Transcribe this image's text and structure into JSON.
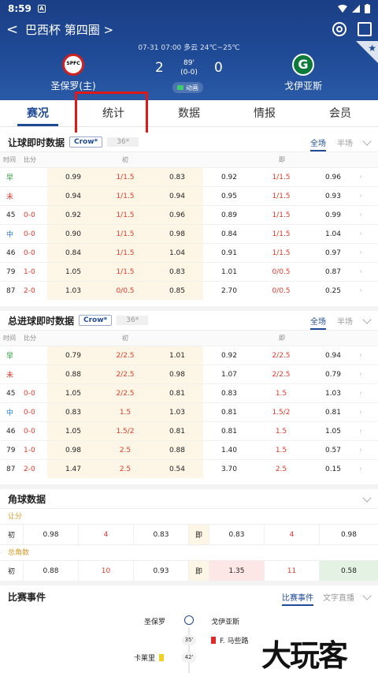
{
  "status": {
    "time": "8:59",
    "notif": "A"
  },
  "header": {
    "title": "巴西杯 第四圈 >",
    "back": "<",
    "meta": "07-31 07:00  多云 24℃~25℃",
    "home_name": "圣保罗(主)",
    "away_name": "戈伊亚斯",
    "away_logo": "G",
    "home_score": "2",
    "away_score": "0",
    "minute": "89'",
    "half_score": "(0-0)",
    "anim_label": "动画",
    "colors": {
      "bg": "#1f4a96",
      "accent": "#e01818"
    }
  },
  "tabs": [
    "赛况",
    "统计",
    "数据",
    "情报",
    "会员"
  ],
  "handicap": {
    "title": "让球即时数据",
    "badge": "Crow*",
    "badge2": "36*",
    "full": "全场",
    "half": "半场",
    "cols": {
      "time": "时间",
      "score": "比分",
      "early": "初",
      "live": "即"
    },
    "rows": [
      {
        "t": "早",
        "s": "",
        "a": "0.99",
        "b": "1/1.5",
        "c": "0.83",
        "d": "0.92",
        "e": "1/1.5",
        "f": "0.96"
      },
      {
        "t": "未",
        "s": "",
        "a": "0.94",
        "b": "1/1.5",
        "c": "0.94",
        "d": "0.95",
        "e": "1/1.5",
        "f": "0.93"
      },
      {
        "t": "45",
        "s": "0-0",
        "a": "0.92",
        "b": "1/1.5",
        "c": "0.96",
        "d": "0.89",
        "e": "1/1.5",
        "f": "0.99"
      },
      {
        "t": "中",
        "s": "0-0",
        "a": "0.90",
        "b": "1/1.5",
        "c": "0.98",
        "d": "0.84",
        "e": "1/1.5",
        "f": "1.04"
      },
      {
        "t": "46",
        "s": "0-0",
        "a": "0.84",
        "b": "1/1.5",
        "c": "1.04",
        "d": "0.91",
        "e": "1/1.5",
        "f": "0.97"
      },
      {
        "t": "79",
        "s": "1-0",
        "a": "1.05",
        "b": "1/1.5",
        "c": "0.83",
        "d": "1.01",
        "e": "0/0.5",
        "f": "0.87"
      },
      {
        "t": "87",
        "s": "2-0",
        "a": "1.03",
        "b": "0/0.5",
        "c": "0.85",
        "d": "2.70",
        "e": "0/0.5",
        "f": "0.25"
      }
    ]
  },
  "totals": {
    "title": "总进球即时数据",
    "badge": "Crow*",
    "badge2": "36*",
    "full": "全场",
    "half": "半场",
    "cols": {
      "time": "时间",
      "score": "比分",
      "early": "初",
      "live": "即"
    },
    "rows": [
      {
        "t": "早",
        "s": "",
        "a": "0.79",
        "b": "2/2.5",
        "c": "1.01",
        "d": "0.92",
        "e": "2/2.5",
        "f": "0.94"
      },
      {
        "t": "未",
        "s": "",
        "a": "0.88",
        "b": "2/2.5",
        "c": "0.98",
        "d": "1.07",
        "e": "2/2.5",
        "f": "0.79"
      },
      {
        "t": "45",
        "s": "0-0",
        "a": "1.05",
        "b": "2/2.5",
        "c": "0.81",
        "d": "0.83",
        "e": "1.5",
        "f": "1.03"
      },
      {
        "t": "中",
        "s": "0-0",
        "a": "0.83",
        "b": "1.5",
        "c": "1.03",
        "d": "0.81",
        "e": "1.5/2",
        "f": "0.81"
      },
      {
        "t": "46",
        "s": "0-0",
        "a": "1.05",
        "b": "1.5/2",
        "c": "0.81",
        "d": "0.81",
        "e": "1.5",
        "f": "1.05"
      },
      {
        "t": "79",
        "s": "1-0",
        "a": "0.98",
        "b": "2.5",
        "c": "0.88",
        "d": "1.40",
        "e": "1.5",
        "f": "0.57"
      },
      {
        "t": "87",
        "s": "2-0",
        "a": "1.47",
        "b": "2.5",
        "c": "0.54",
        "d": "3.70",
        "e": "2.5",
        "f": "0.15"
      }
    ]
  },
  "corners": {
    "title": "角球数据",
    "handicap_label": "让分",
    "total_label": "总角数",
    "h": {
      "l1": "初",
      "v1": "0.98",
      "v2": "4",
      "v3": "0.83",
      "l2": "即",
      "v4": "0.83",
      "v5": "4",
      "v6": "0.98"
    },
    "t": {
      "l1": "初",
      "v1": "0.88",
      "v2": "10",
      "v3": "0.93",
      "l2": "即",
      "v4": "1.35",
      "v5": "11",
      "v6": "0.58"
    }
  },
  "events": {
    "title": "比赛事件",
    "tab_on": "比赛事件",
    "tab_off": "文字直播",
    "home": "圣保罗",
    "away": "戈伊亚斯",
    "items": [
      {
        "min": "35'",
        "player": "F. 马些路"
      },
      {
        "min": "42'",
        "player": "卡莱里"
      }
    ]
  },
  "watermark": "大玩客"
}
